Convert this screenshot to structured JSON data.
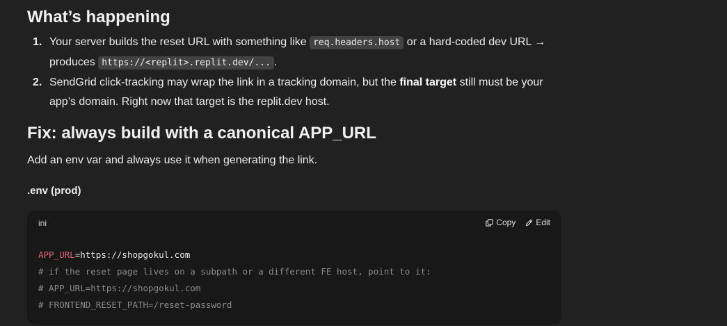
{
  "sections": {
    "whats_happening": "What’s happening",
    "fix": "Fix: always build with a canonical APP_URL"
  },
  "steps": [
    {
      "num": "1.",
      "text_a": "Your server builds the reset URL with something like ",
      "code_a": "req.headers.host",
      "text_b": " or a hard-coded dev URL → produces ",
      "code_b": "https://<replit>.replit.dev/...",
      "text_c": "."
    },
    {
      "num": "2.",
      "text_a": "SendGrid click-tracking may wrap the link in a tracking domain, but the ",
      "bold": "final target",
      "text_b": " still must be your app’s domain. Right now that target is the replit.dev host."
    }
  ],
  "paragraph": "Add an env var and always use it when generating the link.",
  "file_label": ".env (prod)",
  "codeblock": {
    "lang": "ini",
    "copy_label": "Copy",
    "edit_label": "Edit",
    "copy_icon": "copy-icon",
    "edit_icon": "pencil-icon",
    "lines": {
      "l1_key": "APP_URL",
      "l1_rest": "=https://shopgokul.com",
      "l2": "# if the reset page lives on a subpath or a different FE host, point to it:",
      "l3": "# APP_URL=https://shopgokul.com",
      "l4": "# FRONTEND_RESET_PATH=/reset-password"
    }
  },
  "colors": {
    "background": "#212121",
    "code_bg": "#181818",
    "inline_code_bg": "#424242",
    "key_color": "#e0607e",
    "comment_color": "#8a8a8a"
  }
}
